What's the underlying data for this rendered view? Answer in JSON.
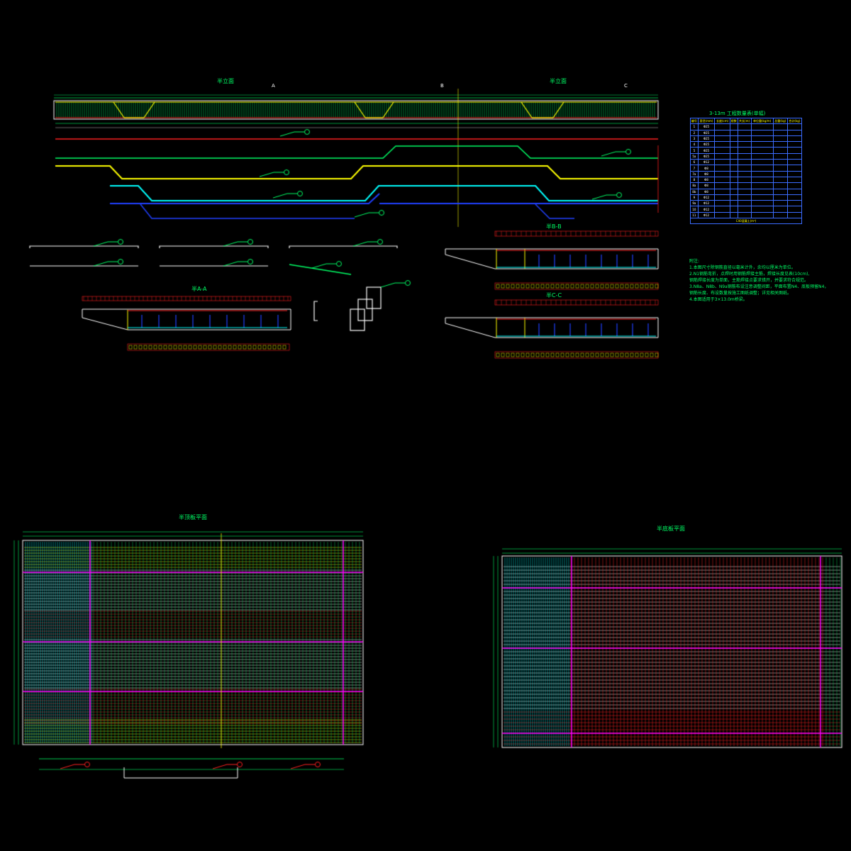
{
  "titles": {
    "elevation_left": "半立面",
    "elevation_right": "半立面",
    "section_a": "半A-A",
    "section_b": "半B-B",
    "section_c": "半C-C",
    "plan_top": "半顶板平面",
    "plan_bottom": "半底板平面"
  },
  "section_marks": [
    "A",
    "B",
    "C"
  ],
  "table": {
    "title": "3-13m 工程数量表(单幅)",
    "columns": [
      "编号",
      "直径(mm)",
      "长度(cm)",
      "根数",
      "共长(m)",
      "单位重(kg/m)",
      "总重(kg)",
      "合计(kg)"
    ],
    "rows": [
      [
        "1",
        "Φ25",
        "",
        "",
        "",
        "",
        "",
        ""
      ],
      [
        "2",
        "Φ25",
        "",
        "",
        "",
        "",
        "",
        ""
      ],
      [
        "3",
        "Φ25",
        "",
        "",
        "",
        "",
        "",
        ""
      ],
      [
        "4",
        "Φ25",
        "",
        "",
        "",
        "",
        "",
        ""
      ],
      [
        "5",
        "Φ25",
        "",
        "",
        "",
        "",
        "",
        ""
      ],
      [
        "5a",
        "Φ25",
        "",
        "",
        "",
        "",
        "",
        ""
      ],
      [
        "6",
        "Φ12",
        "",
        "",
        "",
        "",
        "",
        ""
      ],
      [
        "7",
        "Φ8",
        "",
        "",
        "",
        "",
        "",
        ""
      ],
      [
        "7a",
        "Φ8",
        "",
        "",
        "",
        "",
        "",
        ""
      ],
      [
        "8",
        "Φ8",
        "",
        "",
        "",
        "",
        "",
        ""
      ],
      [
        "8a",
        "Φ8",
        "",
        "",
        "",
        "",
        "",
        ""
      ],
      [
        "8b",
        "Φ8",
        "",
        "",
        "",
        "",
        "",
        ""
      ],
      [
        "9",
        "Φ12",
        "",
        "",
        "",
        "",
        "",
        ""
      ],
      [
        "9a",
        "Φ12",
        "",
        "",
        "",
        "",
        "",
        ""
      ],
      [
        "10",
        "Φ12",
        "",
        "",
        "",
        "",
        "",
        ""
      ],
      [
        "11",
        "Φ12",
        "",
        "",
        "",
        "",
        "",
        ""
      ]
    ],
    "footer": "C40混凝土(m³)"
  },
  "notes": {
    "heading": "附注:",
    "lines": [
      "1.本图尺寸除钢筋直径以毫米计外，余均以厘米为单位。",
      "2.N1钢筋弯折，点焊时用钢筋焊接主筋，焊接长度见表(10cm),",
      "   钢筋焊接长度为单面，主筋焊接点要求错开，并要求符合规范。",
      "3.N8a、N8b、N9a钢筋布设注意调整间距，平面布置N4、底板预留N4，",
      "   钢筋长度、布设数量按施工图纸调整；详见相关图纸。",
      "4.本图适用于3×13.0m桥梁。"
    ]
  },
  "colors": {
    "background": "#000000",
    "outline": "#ffffff",
    "dimension": "#00ff66",
    "rebar_red": "#ff2020",
    "rebar_yellow": "#ffff00",
    "rebar_cyan": "#00ffff",
    "rebar_blue": "#2040ff",
    "rebar_magenta": "#ff00ff",
    "grid_green": "#00cc55"
  }
}
